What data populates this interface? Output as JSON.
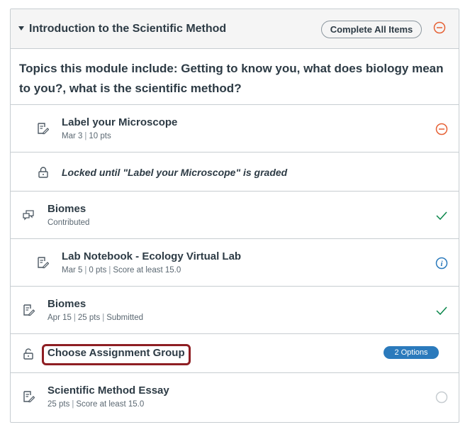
{
  "module": {
    "title": "Introduction to the Scientific Method",
    "complete_all_label": "Complete All Items",
    "overview": "Topics this module include: Getting to know you, what does biology mean to you?, what is the scientific method?"
  },
  "items": [
    {
      "title": "Label your Microscope",
      "meta": [
        "Mar 3",
        "10 pts"
      ],
      "status": "minus-circle-icon"
    },
    {
      "locked_text": "Locked until \"Label your Microscope\" is graded"
    },
    {
      "title": "Biomes",
      "meta": [
        "Contributed"
      ],
      "status": "checkmark-icon"
    },
    {
      "title": "Lab Notebook - Ecology Virtual Lab",
      "meta": [
        "Mar 5",
        "0 pts",
        "Score at least 15.0"
      ],
      "status": "info-icon"
    },
    {
      "title": "Biomes",
      "meta": [
        "Apr 15",
        "25 pts",
        "Submitted"
      ],
      "status": "checkmark-icon"
    },
    {
      "title": "Choose Assignment Group",
      "badge": "2 Options"
    },
    {
      "title": "Scientific Method Essay",
      "meta": [
        "25 pts",
        "Score at least 15.0"
      ],
      "status": "empty-circle-icon"
    }
  ],
  "colors": {
    "accent_orange": "#e66135",
    "success_green": "#0b874b",
    "info_blue": "#2b7abc",
    "highlight_red": "#8e1e23"
  }
}
